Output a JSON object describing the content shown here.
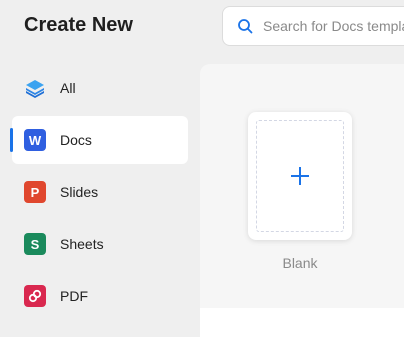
{
  "header": {
    "title": "Create New"
  },
  "search": {
    "placeholder": "Search for Docs templates"
  },
  "sidebar": {
    "items": [
      {
        "label": "All",
        "icon": "layers-icon",
        "active": false
      },
      {
        "label": "Docs",
        "icon": "docs-icon",
        "letter": "W",
        "active": true
      },
      {
        "label": "Slides",
        "icon": "slides-icon",
        "letter": "P",
        "active": false
      },
      {
        "label": "Sheets",
        "icon": "sheets-icon",
        "letter": "S",
        "active": false
      },
      {
        "label": "PDF",
        "icon": "pdf-icon",
        "active": false
      }
    ]
  },
  "templates": [
    {
      "label": "Blank",
      "icon": "plus-icon"
    }
  ],
  "colors": {
    "accent": "#1a73e8",
    "docs": "#2f5fe0",
    "slides": "#e0472e",
    "sheets": "#1a8a5c",
    "pdf": "#d9284f"
  }
}
